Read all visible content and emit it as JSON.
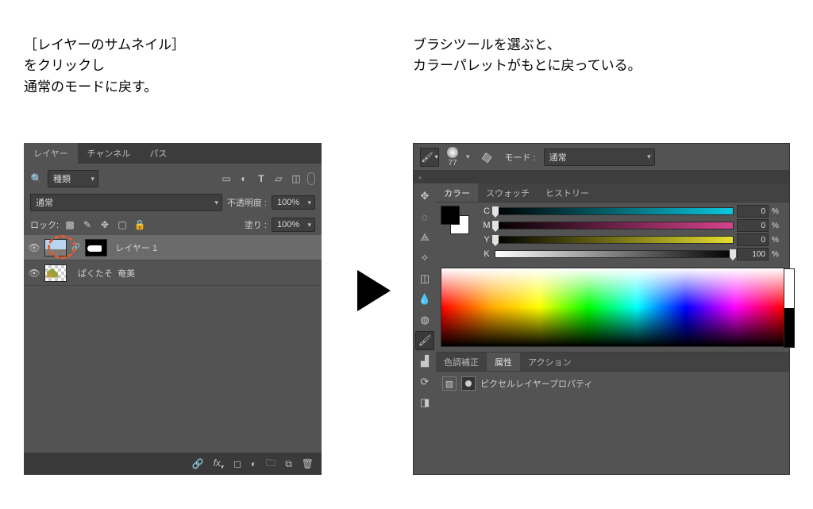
{
  "caption_left_line1": "［レイヤーのサムネイル］",
  "caption_left_line2": "をクリックし",
  "caption_left_line3": "通常のモードに戻す。",
  "caption_right_line1": "ブラシツールを選ぶと、",
  "caption_right_line2": "カラーパレットがもとに戻っている。",
  "layers_panel": {
    "tab_layers": "レイヤー",
    "tab_channel": "チャンネル",
    "tab_path": "パス",
    "filter_kind": "種類",
    "blend_mode": "通常",
    "opacity_label": "不透明度 :",
    "opacity_value": "100%",
    "lock_label": "ロック:",
    "fill_label": "塗り :",
    "fill_value": "100%",
    "layer1_name": "レイヤー 1",
    "layer2_part1": "ぱくたそ",
    "layer2_part2": "奄美"
  },
  "options_bar": {
    "size_value": "77",
    "mode_label": "モード :",
    "mode_value": "通常"
  },
  "color_panel": {
    "tab_color": "カラー",
    "tab_swatch": "スウォッチ",
    "tab_history": "ヒストリー",
    "c_label": "C",
    "c_value": "0",
    "m_label": "M",
    "m_value": "0",
    "y_label": "Y",
    "y_value": "0",
    "k_label": "K",
    "k_value": "100",
    "pct": "%"
  },
  "props_panel": {
    "tab_adj": "色調補正",
    "tab_props": "属性",
    "tab_actions": "アクション",
    "title": "ピクセルレイヤープロパティ"
  }
}
